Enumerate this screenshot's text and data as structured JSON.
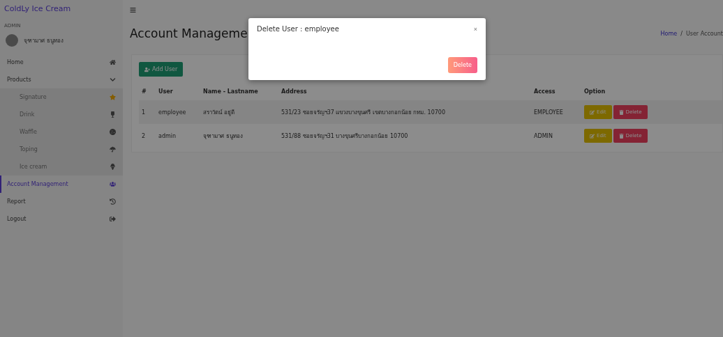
{
  "sidebar": {
    "brand": "ColdLy Ice Cream",
    "role": "ADMIN",
    "user_name": "จุฑามาศ ธนูทอง",
    "items": [
      {
        "label": "Home",
        "selected": false
      },
      {
        "label": "Products",
        "selected": false,
        "expanded": true,
        "children": [
          {
            "label": "Signature",
            "selected": false
          },
          {
            "label": "Drink",
            "selected": false
          },
          {
            "label": "Waffle",
            "selected": false
          },
          {
            "label": "Toping",
            "selected": false
          },
          {
            "label": "Ice cream",
            "selected": false
          }
        ]
      },
      {
        "label": "Account Management",
        "selected": true
      },
      {
        "label": "Report",
        "selected": false
      },
      {
        "label": "Logout",
        "selected": false
      }
    ]
  },
  "header": {
    "title": "Account Manageme",
    "breadcrumb": [
      "Home",
      "User Account"
    ],
    "breadcrumb_separator": "/"
  },
  "add_button": "Add User",
  "table": {
    "columns": [
      "#",
      "User",
      "Name - Lastname",
      "Address",
      "Access",
      "Option"
    ],
    "rows": [
      {
        "cells": [
          "1",
          "employee",
          "สราวัตน์ อยู่ดี",
          "531/23 ซอยจรัญฯ37 แขวงบางขุนศรี เขตบางกอกน้อย กทม. 10700",
          "EMPLOYEE"
        ],
        "actions": [
          "Edit",
          "Delete"
        ]
      },
      {
        "cells": [
          "2",
          "admin",
          "จุฑามาศ ธนูทอง",
          "531/88 ซอยจรัญฯ31 บางขุนศรีบางกอกน้อย 10700",
          "ADMIN"
        ],
        "actions": [
          "Edit",
          "Delete"
        ]
      }
    ]
  },
  "modal": {
    "title": "Delete User : employee",
    "close": "×",
    "confirm": "Delete"
  }
}
